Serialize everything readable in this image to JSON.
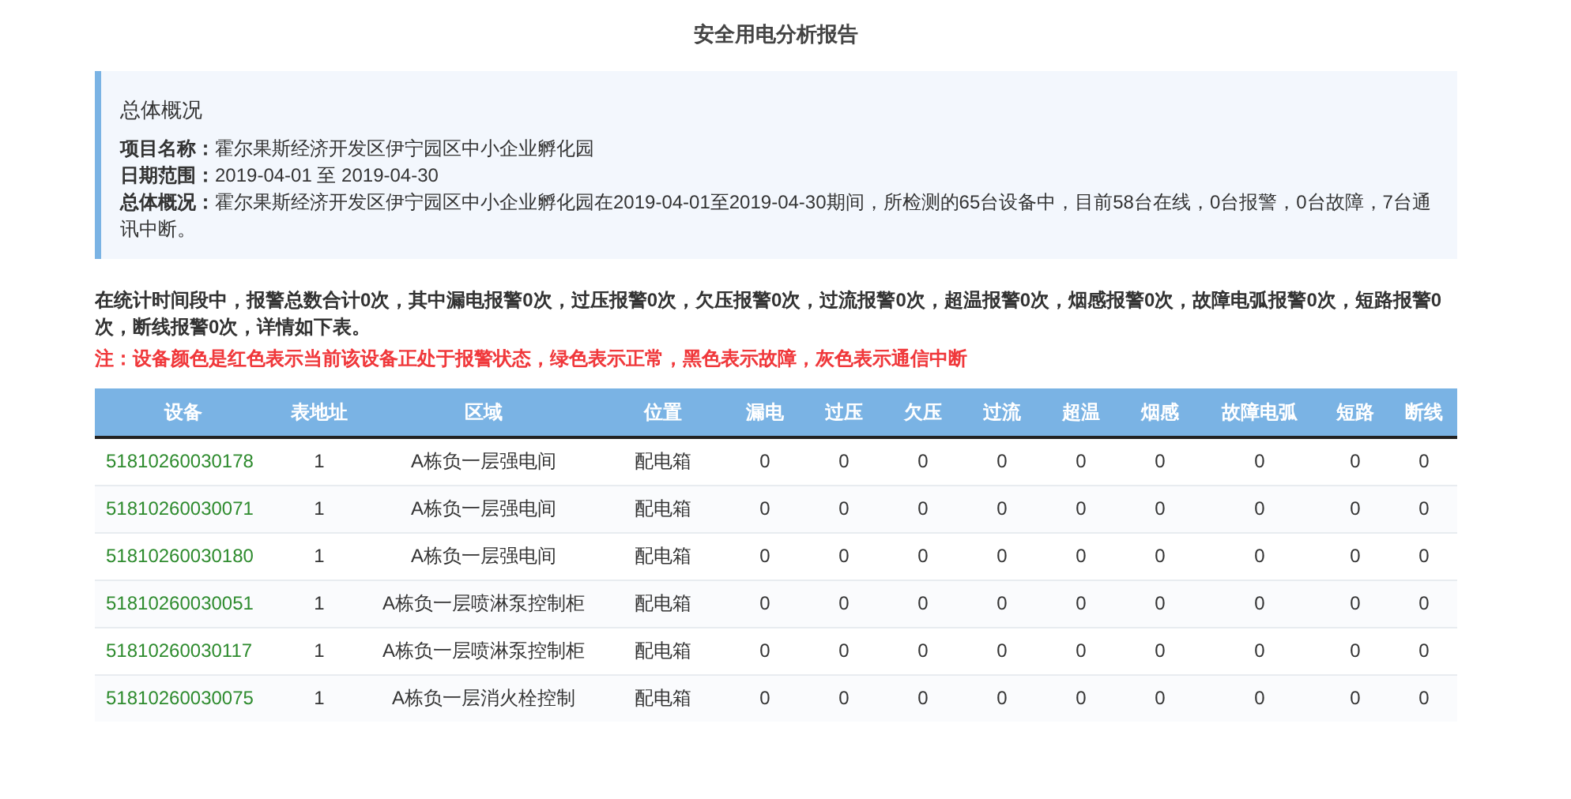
{
  "page_title": "安全用电分析报告",
  "overview": {
    "heading": "总体概况",
    "lines": [
      "**项目名称：**霍尔果斯经济开发区伊宁园区中小企业孵化园",
      "**日期范围：**2019-04-01 至 2019-04-30",
      "**总体概况：**霍尔果斯经济开发区伊宁园区中小企业孵化园在2019-04-01至2019-04-30期间，所检测的65台设备中，目前58台在线，0台报警，0台故障，7台通讯中断。"
    ]
  },
  "statistics_text": "在统计时间段中，报警总数合计0次，其中漏电报警0次，过压报警0次，欠压报警0次，过流报警0次，超温报警0次，烟感报警0次，故障电弧报警0次，短路报警0次，断线报警0次，详情如下表。",
  "note": "注：设备颜色是红色表示当前该设备正处于报警状态，绿色表示正常，黑色表示故障，灰色表示通信中断",
  "table": {
    "columns": [
      "设备",
      "表地址",
      "区域",
      "位置",
      "漏电",
      "过压",
      "欠压",
      "过流",
      "超温",
      "烟感",
      "故障电弧",
      "短路",
      "断线"
    ],
    "rows": [
      {
        "color": "#2e8b2e",
        "cells": [
          "51810260030178",
          "1",
          "A栋负一层强电间",
          "配电箱",
          "0",
          "0",
          "0",
          "0",
          "0",
          "0",
          "0",
          "0",
          "0"
        ]
      },
      {
        "color": "#2e8b2e",
        "cells": [
          "51810260030071",
          "1",
          "A栋负一层强电间",
          "配电箱",
          "0",
          "0",
          "0",
          "0",
          "0",
          "0",
          "0",
          "0",
          "0"
        ]
      },
      {
        "color": "#2e8b2e",
        "cells": [
          "51810260030180",
          "1",
          "A栋负一层强电间",
          "配电箱",
          "0",
          "0",
          "0",
          "0",
          "0",
          "0",
          "0",
          "0",
          "0"
        ]
      },
      {
        "color": "#2e8b2e",
        "cells": [
          "51810260030051",
          "1",
          "A栋负一层喷淋泵控制柜",
          "配电箱",
          "0",
          "0",
          "0",
          "0",
          "0",
          "0",
          "0",
          "0",
          "0"
        ]
      },
      {
        "color": "#2e8b2e",
        "cells": [
          "51810260030117",
          "1",
          "A栋负一层喷淋泵控制柜",
          "配电箱",
          "0",
          "0",
          "0",
          "0",
          "0",
          "0",
          "0",
          "0",
          "0"
        ]
      },
      {
        "color": "#2e8b2e",
        "cells": [
          "51810260030075",
          "1",
          "A栋负一层消火栓控制",
          "配电箱",
          "0",
          "0",
          "0",
          "0",
          "0",
          "0",
          "0",
          "0",
          "0"
        ]
      }
    ]
  }
}
